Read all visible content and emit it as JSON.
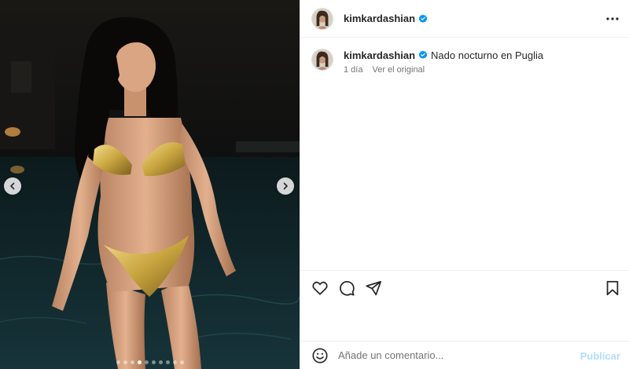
{
  "post": {
    "username": "kimkardashian",
    "verified": true,
    "caption": {
      "username": "kimkardashian",
      "text": "Nado nocturno en Puglia",
      "time": "1 día",
      "see_original": "Ver el original"
    },
    "comment": {
      "placeholder": "Añade un comentario...",
      "publish_label": "Publicar"
    },
    "carousel": {
      "total_slides": 10,
      "active_slide": 4
    }
  },
  "colors": {
    "verified_badge": "#0095f6",
    "publish_disabled": "#b2dffc",
    "muted_text": "#737373",
    "bikini_gold": "#c9a53f"
  },
  "icons": {
    "more": "more-horizontal-icon",
    "like": "heart-icon",
    "comment": "comment-bubble-icon",
    "share": "paper-plane-icon",
    "save": "bookmark-icon",
    "emoji": "emoji-smile-icon",
    "prev": "chevron-left-icon",
    "next": "chevron-right-icon"
  }
}
